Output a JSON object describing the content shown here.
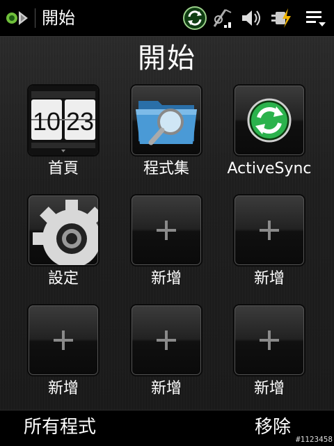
{
  "statusbar": {
    "title": "開始",
    "icons": [
      "start-logo-icon",
      "sync-icon",
      "signal-icon",
      "volume-icon",
      "battery-charging-icon",
      "menu-icon"
    ]
  },
  "page": {
    "title": "開始"
  },
  "tiles": [
    {
      "label": "首頁",
      "icon": "home-clock-icon",
      "clock": [
        "10",
        "23"
      ]
    },
    {
      "label": "程式集",
      "icon": "programs-folder-icon"
    },
    {
      "label": "ActiveSync",
      "icon": "activesync-icon"
    },
    {
      "label": "設定",
      "icon": "settings-gear-icon"
    },
    {
      "label": "新增",
      "icon": "plus-icon"
    },
    {
      "label": "新增",
      "icon": "plus-icon"
    },
    {
      "label": "新增",
      "icon": "plus-icon"
    },
    {
      "label": "新增",
      "icon": "plus-icon"
    },
    {
      "label": "新增",
      "icon": "plus-icon"
    }
  ],
  "softkeys": {
    "left": "所有程式",
    "right": "移除"
  },
  "watermark": "#1123458",
  "colors": {
    "accent_green": "#2bb24c",
    "background": "#1c1c1c",
    "bar": "#000000"
  }
}
